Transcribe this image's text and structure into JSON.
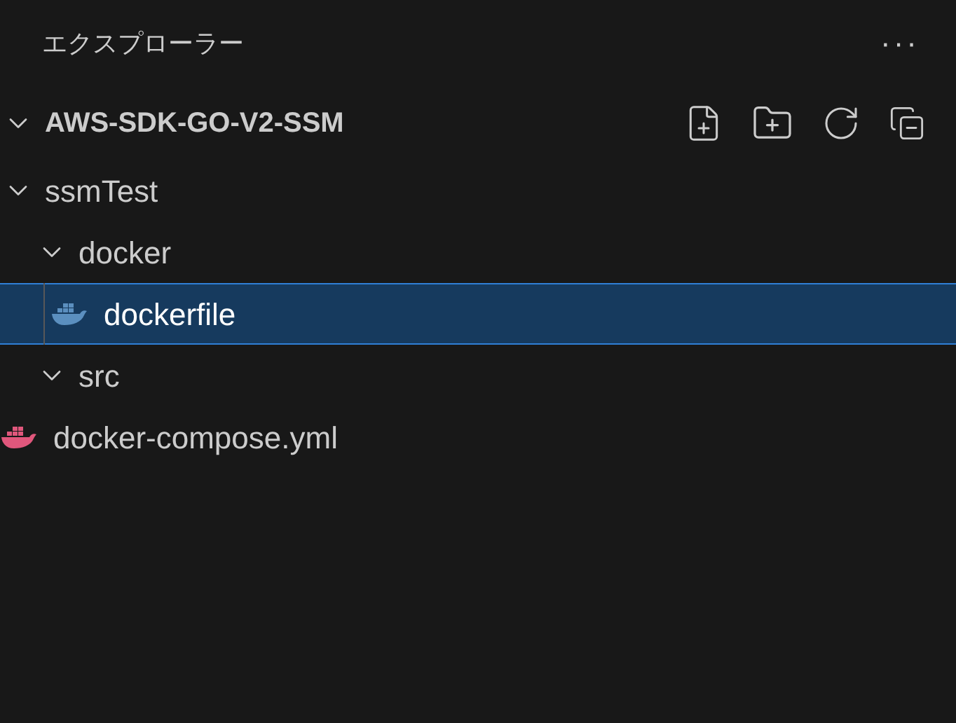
{
  "panel": {
    "title": "エクスプローラー",
    "more": "···"
  },
  "root": {
    "label": "AWS-SDK-GO-V2-SSM",
    "expanded": true,
    "children": [
      {
        "kind": "folder",
        "label": "ssmTest",
        "expanded": true,
        "selected": false,
        "children": [
          {
            "kind": "folder",
            "label": "docker",
            "expanded": true,
            "selected": false,
            "children": [
              {
                "kind": "file",
                "label": "dockerfile",
                "selected": true,
                "color": "#5b8fbf"
              }
            ]
          },
          {
            "kind": "folder",
            "label": "src",
            "expanded": true,
            "selected": false
          }
        ]
      },
      {
        "kind": "file",
        "label": "docker-compose.yml",
        "selected": false,
        "color": "#e0577c"
      }
    ]
  }
}
